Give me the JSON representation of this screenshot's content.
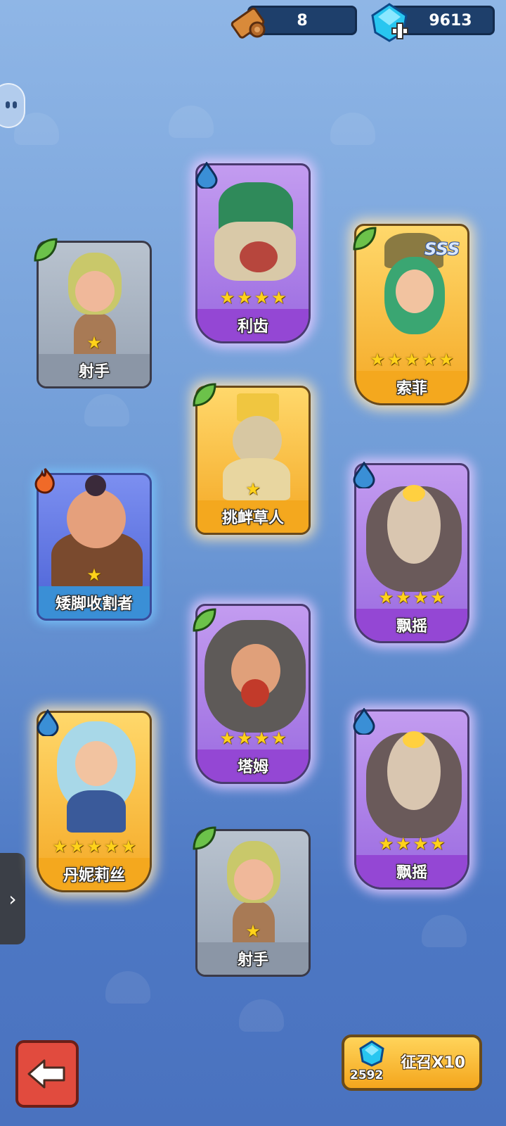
{
  "top_bar": {
    "scrolls_count": "8",
    "gems_count": "9613"
  },
  "cards": [
    {
      "name": "射手",
      "stars": 1,
      "rarity": "gray",
      "element": "leaf"
    },
    {
      "name": "利齿",
      "stars": 4,
      "rarity": "purple",
      "element": "water"
    },
    {
      "name": "索菲",
      "stars": 5,
      "rarity": "gold",
      "element": "leaf",
      "tag": "SSS"
    },
    {
      "name": "挑衅草人",
      "stars": 1,
      "rarity": "gold",
      "element": "leaf"
    },
    {
      "name": "矮脚收割者",
      "stars": 1,
      "rarity": "blue",
      "element": "fire"
    },
    {
      "name": "飘摇",
      "stars": 4,
      "rarity": "purple",
      "element": "water"
    },
    {
      "name": "塔姆",
      "stars": 4,
      "rarity": "purple",
      "element": "leaf"
    },
    {
      "name": "丹妮莉丝",
      "stars": 5,
      "rarity": "gold",
      "element": "water"
    },
    {
      "name": "飘摇",
      "stars": 4,
      "rarity": "purple",
      "element": "water"
    },
    {
      "name": "射手",
      "stars": 1,
      "rarity": "gray",
      "element": "leaf"
    }
  ],
  "summon_button": {
    "label": "征召X10",
    "cost": "2592"
  },
  "colors": {
    "gray": "#8b96a6",
    "blue": "#3a8fd6",
    "purple": "#9447d4",
    "gold": "#f4a81e"
  },
  "icons": [
    "scroll-icon",
    "gem-icon",
    "leaf-icon",
    "water-drop-icon",
    "fire-icon",
    "star-icon",
    "back-arrow-icon",
    "chevron-right-icon"
  ]
}
